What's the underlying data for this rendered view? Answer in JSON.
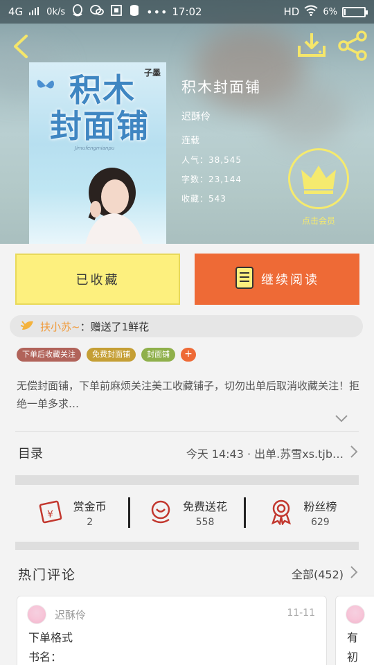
{
  "status_bar": {
    "network": "4G",
    "speed": "0k/s",
    "time": "17:02",
    "hd": "HD",
    "battery_pct": "6%",
    "battery_level": 0.06
  },
  "nav": {
    "back_icon": "back-arrow-icon",
    "download_icon": "download-icon",
    "share_icon": "share-icon"
  },
  "book": {
    "cover_title_line1": "积木",
    "cover_title_line2": "封面铺",
    "cover_badge": "子墨",
    "cover_subtitle": "Jimufengmianpu",
    "title": "积木封面铺",
    "author": "迟酥伶",
    "status": "连载",
    "popularity": "人气：38,545",
    "word_count": "字数：23,144",
    "favorites": "收藏：543"
  },
  "vip": {
    "icon": "crown-icon",
    "label": "点击会员"
  },
  "actions": {
    "favorited_label": "已收藏",
    "continue_label": "继续阅读",
    "continue_icon": "book-icon"
  },
  "gift": {
    "user": "扶小苏~",
    "message": "：赠送了1鲜花"
  },
  "tags": [
    {
      "label": "下单后收藏关注",
      "color": "#b1635a"
    },
    {
      "label": "免费封面铺",
      "color": "#c59f35"
    },
    {
      "label": "封面铺",
      "color": "#8fb04b"
    }
  ],
  "tag_add": "+",
  "description": "无偿封面铺，下单前麻烦关注美工收藏铺子，切勿出单后取消收藏关注！拒绝一单多求…",
  "toc": {
    "label": "目录",
    "latest": "今天 14:43 · 出单.苏雪xs.tjb…"
  },
  "stats": [
    {
      "name": "赏金币",
      "value": "2",
      "icon": "red-envelope-icon"
    },
    {
      "name": "免费送花",
      "value": "558",
      "icon": "flower-icon"
    },
    {
      "name": "粉丝榜",
      "value": "629",
      "icon": "medal-icon"
    }
  ],
  "comments": {
    "header": "热门评论",
    "all_label": "全部(452)",
    "items": [
      {
        "user": "迟酥伶",
        "date": "11-11",
        "line1": "下单格式",
        "line2": "书名："
      },
      {
        "user": "",
        "date": "",
        "line1": "有",
        "line2": "初"
      }
    ]
  },
  "colors": {
    "accent_orange": "#ee6a36",
    "favorite_yellow": "#fdf07e",
    "vip_yellow": "#f5ea6e",
    "gift_user": "#f09b3c"
  }
}
